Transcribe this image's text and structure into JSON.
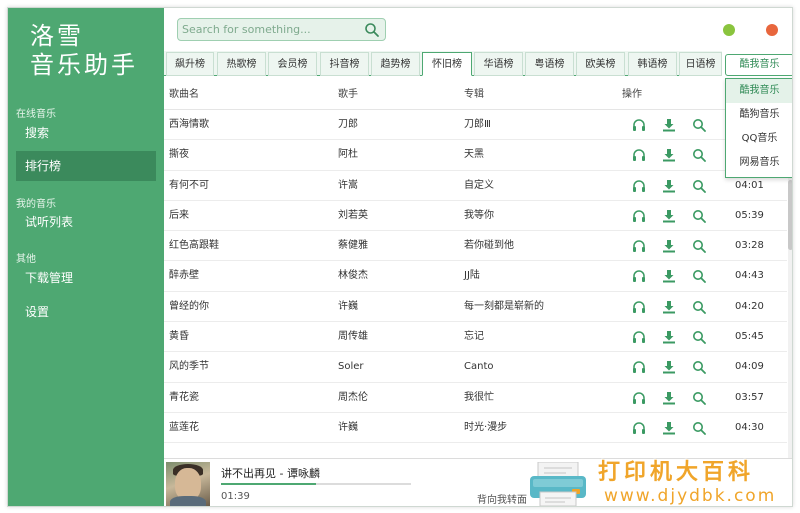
{
  "app": {
    "logo_line1": "洛雪",
    "logo_line2": "音乐助手"
  },
  "sidebar": {
    "sections": [
      {
        "title": "在线音乐",
        "items": [
          {
            "label": "搜索"
          },
          {
            "label": "排行榜",
            "active": true
          }
        ]
      },
      {
        "title": "我的音乐",
        "items": [
          {
            "label": "试听列表"
          }
        ]
      },
      {
        "title": "其他",
        "items": [
          {
            "label": "下载管理"
          },
          {
            "label": "设置"
          }
        ]
      }
    ]
  },
  "search": {
    "placeholder": "Search for something..."
  },
  "tabs": [
    "飙升榜",
    "热歌榜",
    "会员榜",
    "抖音榜",
    "趋势榜",
    "怀旧榜",
    "华语榜",
    "粤语榜",
    "欧美榜",
    "韩语榜",
    "日语榜"
  ],
  "active_tab": "怀旧榜",
  "source": {
    "selected": "酷我音乐",
    "options": [
      "酷我音乐",
      "酷狗音乐",
      "QQ音乐",
      "网易音乐"
    ]
  },
  "table": {
    "headers": {
      "name": "歌曲名",
      "artist": "歌手",
      "album": "专辑",
      "actions": "操作"
    },
    "rows": [
      {
        "name": "西海情歌",
        "artist": "刀郎",
        "album": "刀郎Ⅲ",
        "duration": ""
      },
      {
        "name": "撕夜",
        "artist": "阿杜",
        "album": "天黑",
        "duration": ""
      },
      {
        "name": "有何不可",
        "artist": "许嵩",
        "album": "自定义",
        "duration": "04:01"
      },
      {
        "name": "后来",
        "artist": "刘若英",
        "album": "我等你",
        "duration": "05:39"
      },
      {
        "name": "红色高跟鞋",
        "artist": "蔡健雅",
        "album": "若你碰到他",
        "duration": "03:28"
      },
      {
        "name": "醉赤壁",
        "artist": "林俊杰",
        "album": "JJ陆",
        "duration": "04:43"
      },
      {
        "name": "曾经的你",
        "artist": "许巍",
        "album": "每一刻都是崭新的",
        "duration": "04:20"
      },
      {
        "name": "黄昏",
        "artist": "周传雄",
        "album": "忘记",
        "duration": "05:45"
      },
      {
        "name": "风的季节",
        "artist": "Soler",
        "album": "Canto",
        "duration": "04:09"
      },
      {
        "name": "青花瓷",
        "artist": "周杰伦",
        "album": "我很忙",
        "duration": "03:57"
      },
      {
        "name": "蓝莲花",
        "artist": "许巍",
        "album": "时光·漫步",
        "duration": "04:30"
      }
    ]
  },
  "player": {
    "title": "讲不出再见 - 谭咏麟",
    "time": "01:39",
    "lyric": "背向我转面",
    "progress": 0.5
  },
  "watermark": {
    "main": "打印机大百科",
    "url": "www.djydbk.com"
  },
  "colors": {
    "accent": "#4ea872",
    "accent_dark": "#3b8a5c",
    "close": "#e8663d",
    "minimize": "#8ac43e",
    "watermark": "#f0a52a"
  }
}
